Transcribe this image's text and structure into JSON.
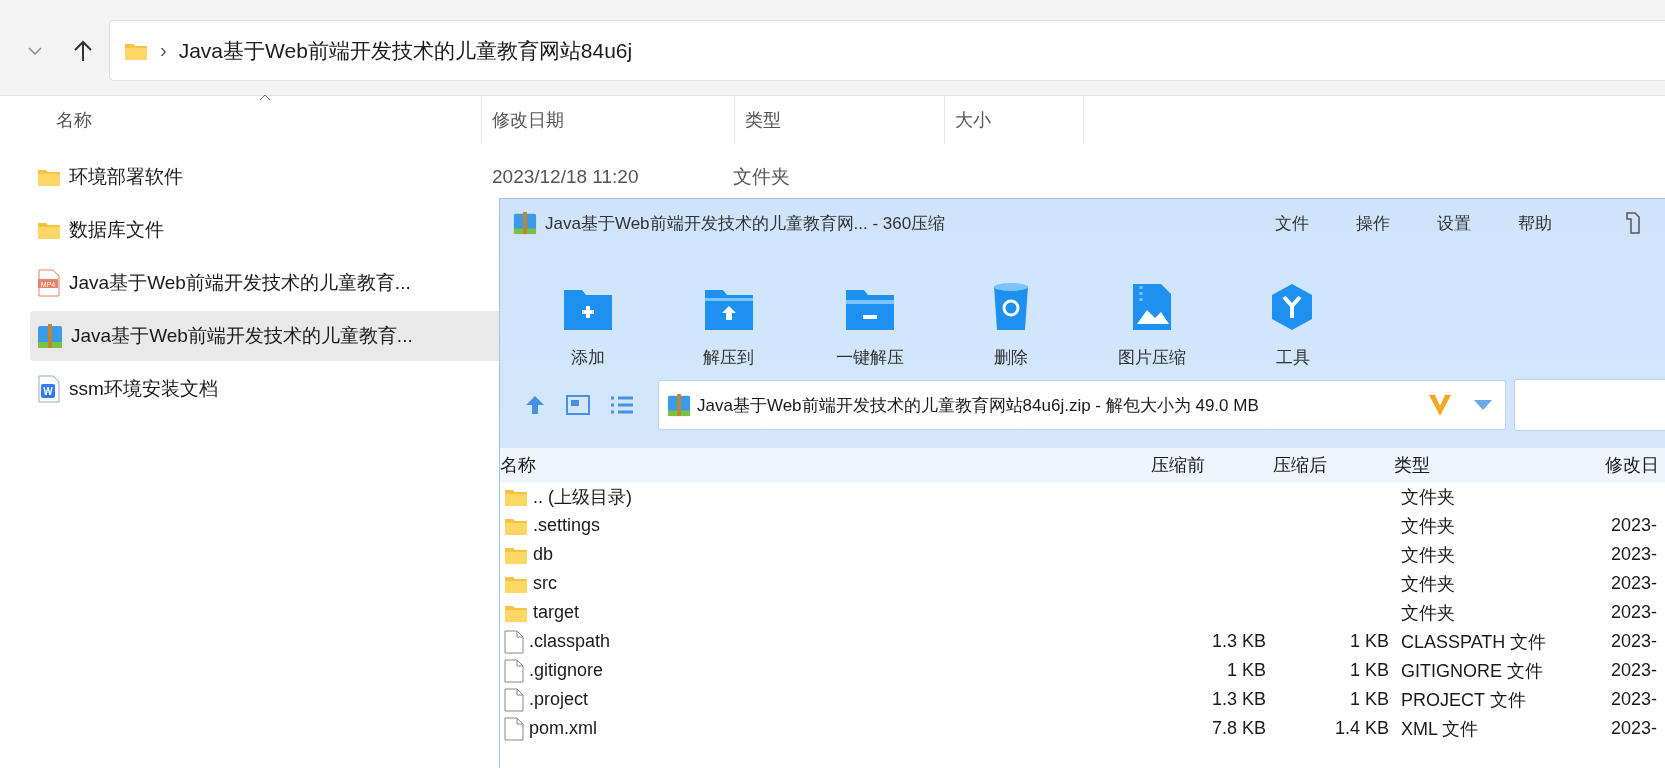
{
  "explorer": {
    "separator": "›",
    "breadcrumb": "Java基于Web前端开发技术的儿童教育网站84u6j",
    "columns": [
      {
        "label": "名称",
        "sorted": true
      },
      {
        "label": "修改日期",
        "sorted": false
      },
      {
        "label": "类型",
        "sorted": false
      },
      {
        "label": "大小",
        "sorted": false
      }
    ],
    "rows": [
      {
        "name": "环境部署软件",
        "kind": "folder",
        "date": "2023/12/18 11:20",
        "type": "文件夹",
        "selected": false
      },
      {
        "name": "数据库文件",
        "kind": "folder",
        "selected": false
      },
      {
        "name": "Java基于Web前端开发技术的儿童教育...",
        "kind": "video",
        "badge": "MP4",
        "selected": false
      },
      {
        "name": "Java基于Web前端开发技术的儿童教育...",
        "kind": "archive",
        "selected": true
      },
      {
        "name": "ssm环境安装文档",
        "kind": "doc",
        "badge": "W",
        "selected": false
      }
    ]
  },
  "archiver": {
    "title": "Java基于Web前端开发技术的儿童教育网... - 360压缩",
    "menu": [
      "文件",
      "操作",
      "设置",
      "帮助"
    ],
    "tools": [
      {
        "label": "添加",
        "kind": "add"
      },
      {
        "label": "解压到",
        "kind": "extract"
      },
      {
        "label": "一键解压",
        "kind": "quick"
      },
      {
        "label": "删除",
        "kind": "delete"
      },
      {
        "label": "图片压缩",
        "kind": "image"
      },
      {
        "label": "工具",
        "kind": "tools"
      }
    ],
    "path": "Java基于Web前端开发技术的儿童教育网站84u6j.zip - 解包大小为 49.0 MB",
    "columns": [
      "名称",
      "压缩前",
      "压缩后",
      "类型",
      "修改日"
    ],
    "rows": [
      {
        "name": ".. (上级目录)",
        "kind": "folder",
        "type": "文件夹"
      },
      {
        "name": ".settings",
        "kind": "folder",
        "type": "文件夹",
        "date": "2023-"
      },
      {
        "name": "db",
        "kind": "folder",
        "type": "文件夹",
        "date": "2023-"
      },
      {
        "name": "src",
        "kind": "folder",
        "type": "文件夹",
        "date": "2023-"
      },
      {
        "name": "target",
        "kind": "folder",
        "type": "文件夹",
        "date": "2023-"
      },
      {
        "name": ".classpath",
        "kind": "file",
        "before": "1.3 KB",
        "after": "1 KB",
        "type": "CLASSPATH 文件",
        "date": "2023-"
      },
      {
        "name": ".gitignore",
        "kind": "file",
        "before": "1 KB",
        "after": "1 KB",
        "type": "GITIGNORE 文件",
        "date": "2023-"
      },
      {
        "name": ".project",
        "kind": "file",
        "before": "1.3 KB",
        "after": "1 KB",
        "type": "PROJECT 文件",
        "date": "2023-"
      },
      {
        "name": "pom.xml",
        "kind": "file",
        "before": "7.8 KB",
        "after": "1.4 KB",
        "type": "XML 文件",
        "date": "2023-"
      }
    ]
  }
}
